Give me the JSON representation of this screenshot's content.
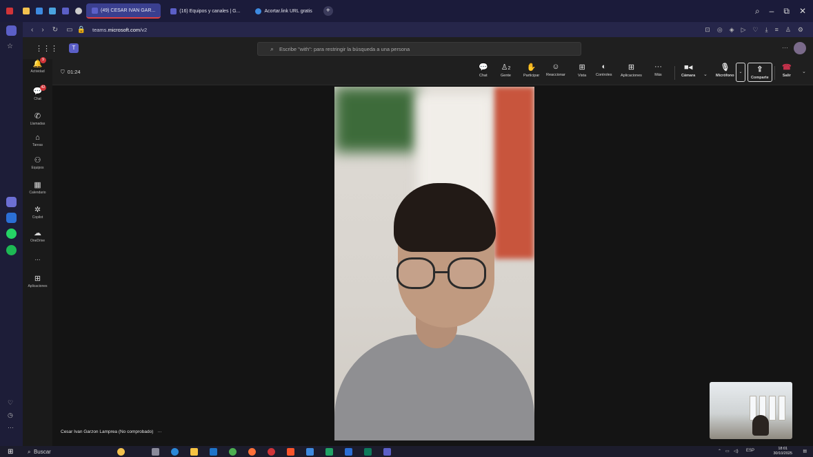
{
  "browser": {
    "tabs": [
      {
        "label": "(49) CESAR IVAN GAR...",
        "active": true
      },
      {
        "label": "(16) Equipos y canales | G...",
        "active": false
      },
      {
        "label": "Acortar.link URL gratis",
        "active": false
      }
    ],
    "url_prefix": "teams.",
    "url_domain": "microsoft.com",
    "url_path": "/v2"
  },
  "teams": {
    "search_placeholder": "Escribe \"with\": para restringir la búsqueda a una persona",
    "rail": [
      {
        "label": "Actividad",
        "icon": "bell-icon",
        "glyph": "🔔",
        "badge": "9"
      },
      {
        "label": "Chat",
        "icon": "chat-icon",
        "glyph": "💬",
        "badge": "42"
      },
      {
        "label": "Llamadas",
        "icon": "phone-icon",
        "glyph": "✆",
        "badge": ""
      },
      {
        "label": "Tareas",
        "icon": "tasks-icon",
        "glyph": "⌂",
        "badge": ""
      },
      {
        "label": "Equipos",
        "icon": "teams-icon",
        "glyph": "⚇",
        "badge": ""
      },
      {
        "label": "Calendario",
        "icon": "calendar-icon",
        "glyph": "▦",
        "badge": ""
      },
      {
        "label": "Copilot",
        "icon": "copilot-icon",
        "glyph": "✲",
        "badge": ""
      },
      {
        "label": "OneDrive",
        "icon": "cloud-icon",
        "glyph": "☁",
        "badge": ""
      },
      {
        "label": "...",
        "icon": "more-icon",
        "glyph": "",
        "badge": ""
      },
      {
        "label": "Aplicaciones",
        "icon": "apps-icon",
        "glyph": "⊞",
        "badge": ""
      }
    ]
  },
  "meeting": {
    "timer": "01:24",
    "tools": {
      "chat": "Chat",
      "people": "Gente",
      "people_count": "2",
      "raise": "Participar",
      "react": "Reaccionar",
      "view": "Vista",
      "controls": "Controles",
      "apps": "Aplicaciones",
      "more": "Más",
      "camera": "Cámara",
      "mic": "Micrófono",
      "share": "Comparte",
      "leave": "Salir"
    },
    "participant_caption": "Cesar Ivan Garzon Lamprea (No comprobado)",
    "caption_more": "···"
  },
  "taskbar": {
    "search": "Buscar",
    "lang": "ESP",
    "time": "18:01",
    "date": "30/10/2025"
  },
  "colors": {
    "teams_accent": "#5b5fc7",
    "leave_red": "#c4314b",
    "badge_red": "#d13438"
  }
}
